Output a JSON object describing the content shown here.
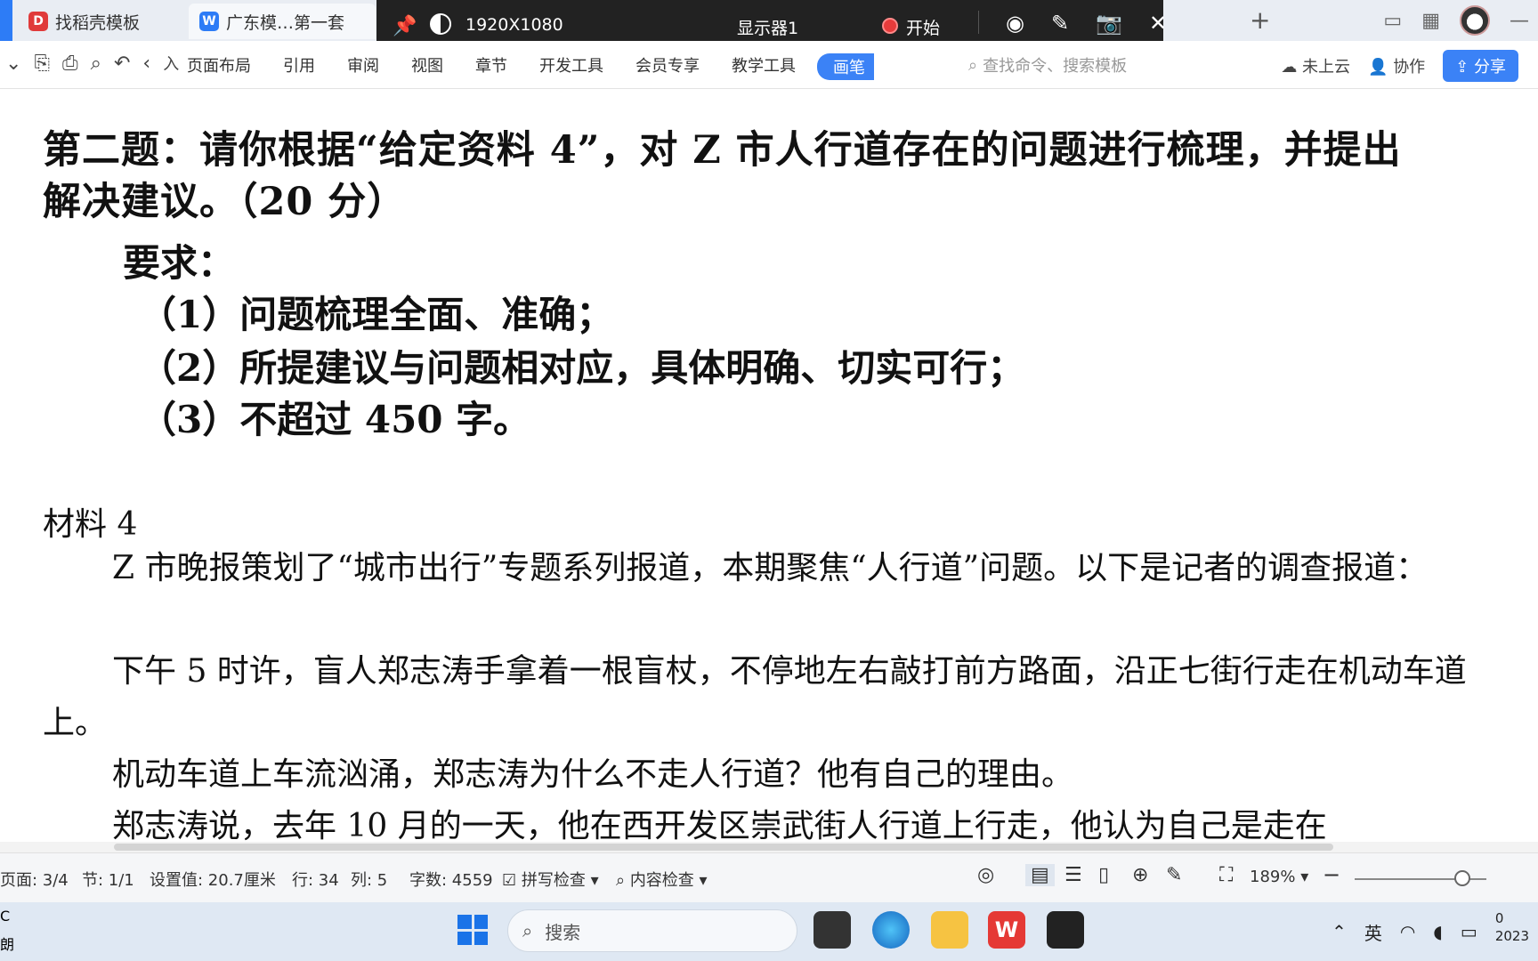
{
  "tabs": [
    {
      "label": "找稻壳模板",
      "icon": "docer-icon"
    },
    {
      "label": "广东模…第一套",
      "icon": "wps-writer-icon"
    }
  ],
  "recorder": {
    "resolution": "1920X1080",
    "display": "显示器1",
    "start": "开始"
  },
  "ribbon": {
    "partial_tab": "入",
    "menu": [
      "页面布局",
      "引用",
      "审阅",
      "视图",
      "章节",
      "开发工具",
      "会员专享",
      "教学工具",
      "画笔"
    ],
    "search_placeholder": "查找命令、搜索模板",
    "cloud": "未上云",
    "collab": "协作",
    "share": "分享"
  },
  "document": {
    "title_line1": "第二题：请你根据“给定资料 4”，对 Z 市人行道存在的问题进行梳理，并提出",
    "title_line2": "解决建议。（20 分）",
    "requirements_label": "要求：",
    "requirements": [
      "（1）问题梳理全面、准确；",
      "（2）所提建议与问题相对应，具体明确、切实可行；",
      "（3）不超过 450 字。"
    ],
    "material_label": "材料 4",
    "paragraphs": [
      "Z 市晚报策划了“城市出行”专题系列报道，本期聚焦“人行道”问题。以下是记者的调查报道：",
      "下午 5 时许，盲人郑志涛手拿着一根盲杖，不停地左右敲打前方路面，沿正七街行走在机动车道上。",
      "机动车道上车流汹涌，郑志涛为什么不走人行道？他有自己的理由。",
      "郑志涛说，去年 10 月的一天，他在西开发区崇武街人行道上行走，他认为自己是走在"
    ]
  },
  "status": {
    "page": "页面: 3/4",
    "section": "节: 1/1",
    "setting": "设置值: 20.7厘米",
    "row": "行: 34",
    "col": "列: 5",
    "words": "字数: 4559",
    "spell": "拼写检查",
    "content_check": "内容检查",
    "zoom": "189%"
  },
  "taskbar": {
    "search": "搜索",
    "lang": "英",
    "clock_top": "0",
    "clock_bottom": "2023",
    "left_edge_top": "C",
    "left_edge_bottom": "朗"
  }
}
